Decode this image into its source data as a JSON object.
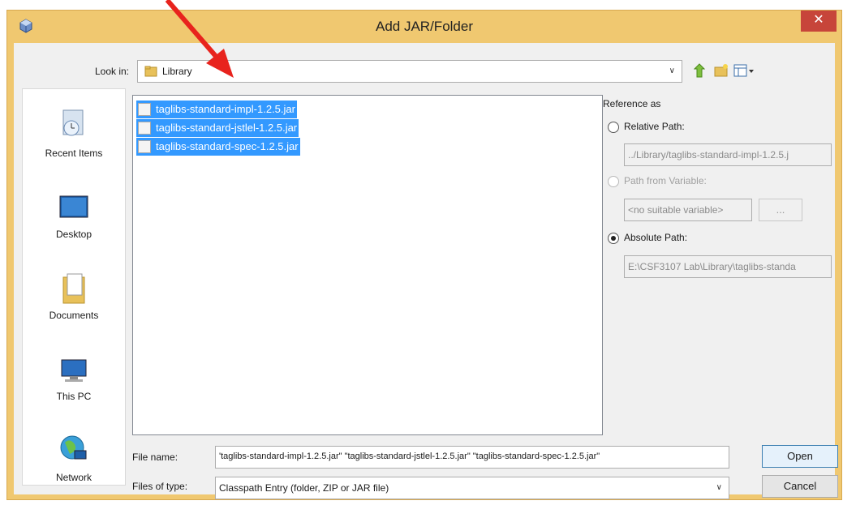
{
  "window": {
    "title": "Add JAR/Folder",
    "close_glyph": "✕"
  },
  "lookin": {
    "label": "Look in:",
    "value": "Library",
    "arrow": "∨"
  },
  "places": [
    {
      "label": "Recent Items",
      "icon": "recent-items-icon"
    },
    {
      "label": "Desktop",
      "icon": "desktop-icon"
    },
    {
      "label": "Documents",
      "icon": "documents-icon"
    },
    {
      "label": "This PC",
      "icon": "this-pc-icon"
    },
    {
      "label": "Network",
      "icon": "network-icon"
    }
  ],
  "files": [
    {
      "name": "taglibs-standard-impl-1.2.5.jar",
      "selected": true
    },
    {
      "name": "taglibs-standard-jstlel-1.2.5.jar",
      "selected": true
    },
    {
      "name": "taglibs-standard-spec-1.2.5.jar",
      "selected": true
    }
  ],
  "reference": {
    "title": "Reference as",
    "relative_label": "Relative Path:",
    "relative_value": "../Library/taglibs-standard-impl-1.2.5.j",
    "variable_label": "Path from Variable:",
    "variable_value": "<no suitable variable>",
    "variable_button": "...",
    "absolute_label": "Absolute Path:",
    "absolute_value": "E:\\CSF3107 Lab\\Library\\taglibs-standa",
    "selected": "absolute"
  },
  "filename": {
    "label": "File name:",
    "value": "'taglibs-standard-impl-1.2.5.jar\" \"taglibs-standard-jstlel-1.2.5.jar\" \"taglibs-standard-spec-1.2.5.jar\""
  },
  "filetype": {
    "label": "Files of type:",
    "value": "Classpath Entry (folder, ZIP or JAR file)",
    "arrow": "∨"
  },
  "buttons": {
    "open": "Open",
    "cancel": "Cancel"
  },
  "colors": {
    "frame": "#f0c870",
    "selection": "#3399ff",
    "close": "#c7453a",
    "annotation_arrow": "#e8231d"
  }
}
